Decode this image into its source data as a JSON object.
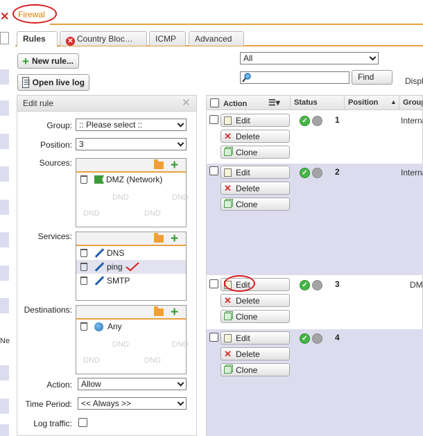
{
  "window": {
    "close_glyph": "✕",
    "title_tab": "Firewal"
  },
  "tabs": [
    {
      "label": "Rules",
      "active": true
    },
    {
      "label": "Country Bloc…",
      "icon": "red-x-icon"
    },
    {
      "label": "ICMP"
    },
    {
      "label": "Advanced"
    }
  ],
  "toolbar": {
    "new_rule": "New rule...",
    "open_live_log": "Open live log"
  },
  "filter": {
    "scope_value": "All",
    "search_value": "",
    "find_label": "Find",
    "display_label": "Displ"
  },
  "sidebar": {
    "fragment_label": "Ne"
  },
  "edit_rule": {
    "title": "Edit rule",
    "close_glyph": "✕",
    "group_label": "Group:",
    "group_value": ":: Please select ::",
    "position_label": "Position:",
    "position_value": "3",
    "sources_label": "Sources:",
    "sources": [
      "DMZ (Network)"
    ],
    "services_label": "Services:",
    "services": [
      "DNS",
      "ping",
      "SMTP"
    ],
    "destinations_label": "Destinations:",
    "destinations": [
      "Any"
    ],
    "dnd_text": "DND",
    "action_label": "Action:",
    "action_value": "Allow",
    "time_period_label": "Time Period:",
    "time_period_value": "<< Always >>",
    "log_traffic_label": "Log traffic:",
    "log_traffic_checked": false
  },
  "rules_table": {
    "headers": {
      "action": "Action",
      "status": "Status",
      "position": "Position",
      "group": "Group"
    },
    "button_labels": {
      "edit": "Edit",
      "delete": "Delete",
      "clone": "Clone"
    },
    "rows": [
      {
        "position": "1",
        "group": "Interna",
        "enabled": true
      },
      {
        "position": "2",
        "group": "Interna",
        "enabled": true
      },
      {
        "position": "3",
        "group": "DM",
        "enabled": true
      },
      {
        "position": "4",
        "group": "",
        "enabled": true
      }
    ]
  },
  "colors": {
    "accent_orange": "#e8a040",
    "row_alt": "#dcdcee",
    "status_green": "#47b647",
    "annotation_red": "#d81b1b"
  },
  "icons": [
    "close-icon",
    "red-x-icon",
    "plus-icon",
    "log-icon",
    "search-icon",
    "folder-icon",
    "trash-icon",
    "flag-icon",
    "service-icon",
    "globe-icon",
    "edit-icon",
    "delete-icon",
    "clone-icon"
  ]
}
